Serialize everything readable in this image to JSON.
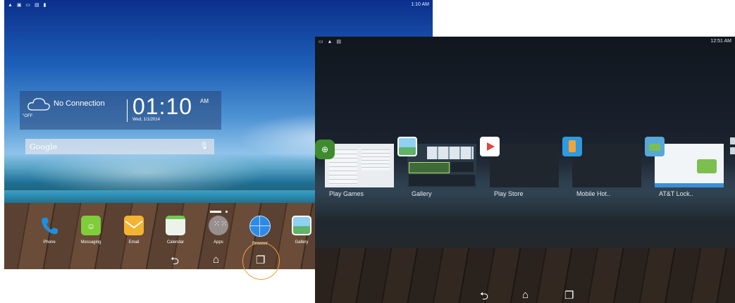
{
  "home": {
    "status_time": "1:10 AM",
    "weather": {
      "condition": "No Connection",
      "temp": "°OFF"
    },
    "clock": {
      "time": "01:10",
      "ampm": "AM",
      "date": "Wed, 1/1/2014"
    },
    "search_placeholder": "Google",
    "dock": [
      {
        "label": "Phone",
        "icon": "phone-icon",
        "color": "#1e8fe0"
      },
      {
        "label": "Messaging",
        "icon": "messaging-icon",
        "color": "#7fcd3a"
      },
      {
        "label": "Email",
        "icon": "email-icon",
        "color": "#f4b431"
      },
      {
        "label": "Calendar",
        "icon": "calendar-icon",
        "color": "#6fcb4d"
      },
      {
        "label": "Apps",
        "icon": "apps-grid-icon",
        "color": "#9aa7b5"
      },
      {
        "label": "Browser",
        "icon": "browser-globe-icon",
        "color": "#2e8ae6"
      },
      {
        "label": "Gallery",
        "icon": "gallery-icon",
        "color": "#5cb4e8"
      }
    ],
    "nav": {
      "back": "⮌",
      "home": "⌂",
      "recents": "❐"
    }
  },
  "recents": {
    "status_time": "12:51 AM",
    "apps": [
      {
        "label": "Play Games",
        "icon": "play-games-icon",
        "icon_color": "#3d8b2e",
        "thumb_color": "#e9edf0"
      },
      {
        "label": "Gallery",
        "icon": "gallery-icon",
        "icon_color": "#5cb4e8",
        "thumb_color": "#2b3a46"
      },
      {
        "label": "Play Store",
        "icon": "play-store-icon",
        "icon_color": "#ffffff",
        "thumb_color": "#20262d"
      },
      {
        "label": "Mobile Hot..",
        "icon": "mobile-hotspot-icon",
        "icon_color": "#2e9ae0",
        "thumb_color": "#20262d"
      },
      {
        "label": "AT&T Lock..",
        "icon": "att-lock-icon",
        "icon_color": "#56a8d8",
        "thumb_color": "#f2f5f7"
      }
    ],
    "nav": {
      "back": "⮌",
      "home": "⌂",
      "recents": "❐"
    }
  }
}
